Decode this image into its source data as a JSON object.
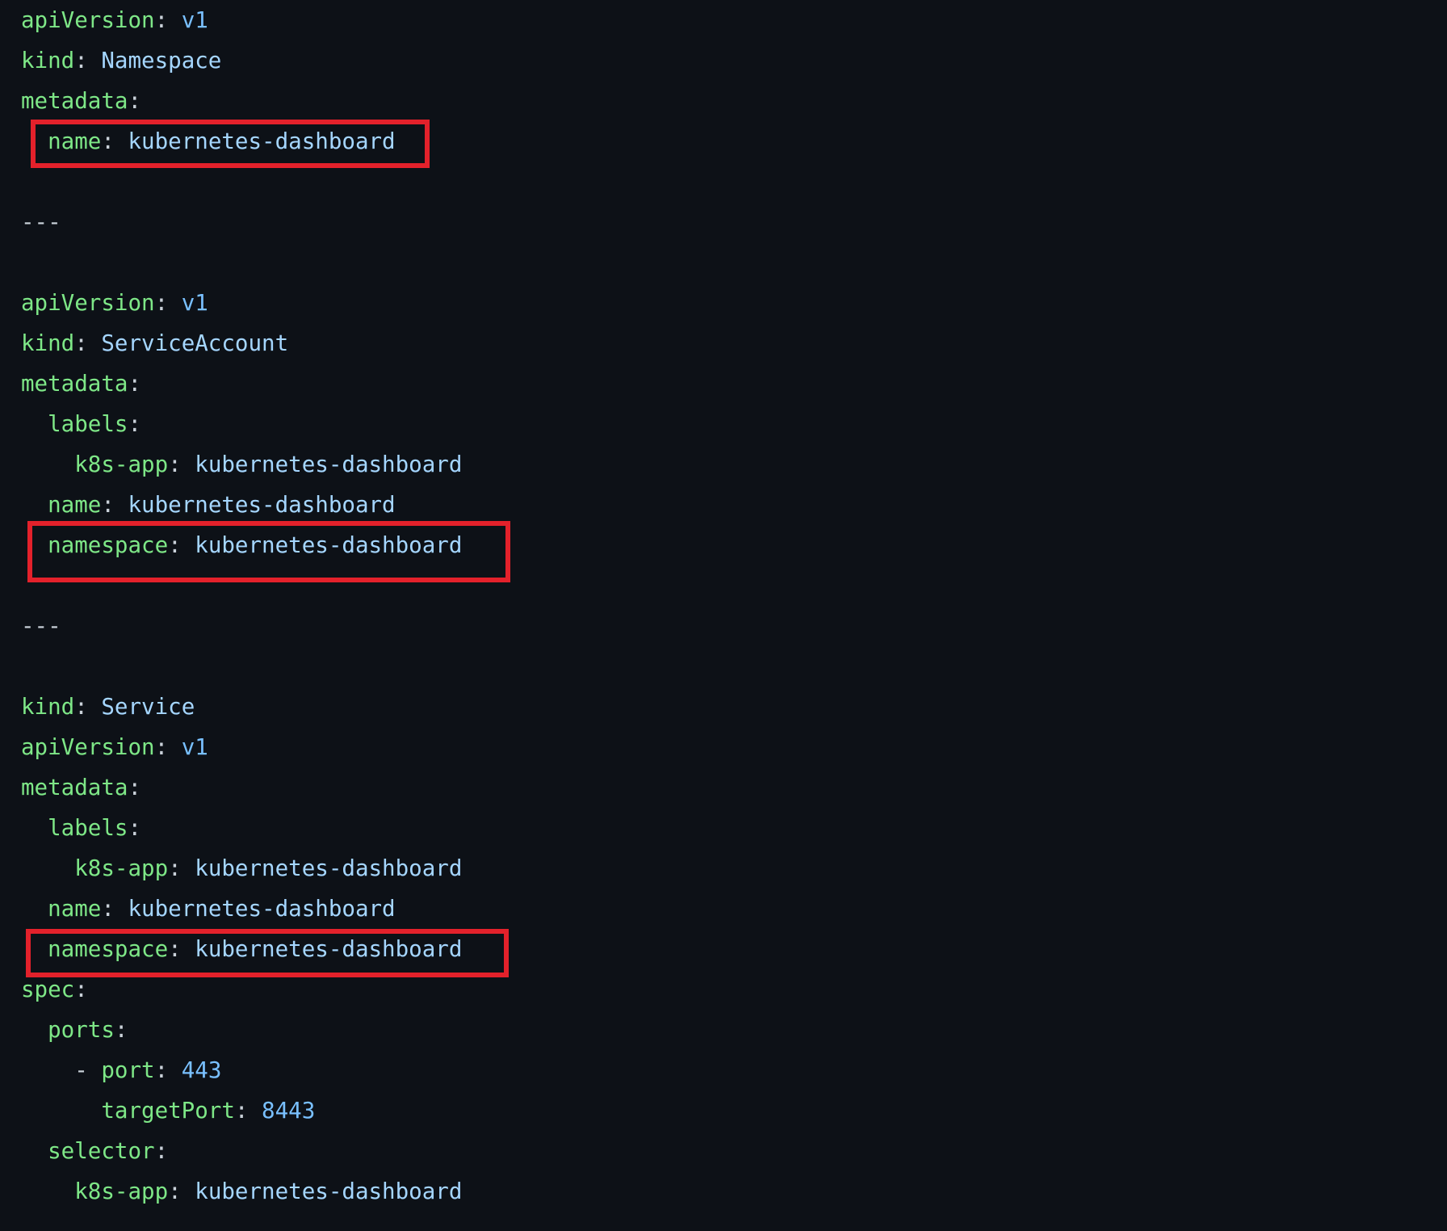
{
  "code_lines": [
    {
      "indent": "",
      "dash": "",
      "key": "apiVersion",
      "colon": ":",
      "value": "v1",
      "value_type": "number"
    },
    {
      "indent": "",
      "dash": "",
      "key": "kind",
      "colon": ":",
      "value": "Namespace",
      "value_type": "string"
    },
    {
      "indent": "",
      "dash": "",
      "key": "metadata",
      "colon": ":",
      "value": "",
      "value_type": "string"
    },
    {
      "indent": "  ",
      "dash": "",
      "key": "name",
      "colon": ":",
      "value": "kubernetes-dashboard",
      "value_type": "string"
    },
    {
      "indent": "",
      "dash": "",
      "key": "",
      "colon": "",
      "value": "",
      "value_type": "string"
    },
    {
      "indent": "",
      "dash": "",
      "key": "",
      "colon": "",
      "value": "---",
      "value_type": "separator"
    },
    {
      "indent": "",
      "dash": "",
      "key": "",
      "colon": "",
      "value": "",
      "value_type": "string"
    },
    {
      "indent": "",
      "dash": "",
      "key": "apiVersion",
      "colon": ":",
      "value": "v1",
      "value_type": "number"
    },
    {
      "indent": "",
      "dash": "",
      "key": "kind",
      "colon": ":",
      "value": "ServiceAccount",
      "value_type": "string"
    },
    {
      "indent": "",
      "dash": "",
      "key": "metadata",
      "colon": ":",
      "value": "",
      "value_type": "string"
    },
    {
      "indent": "  ",
      "dash": "",
      "key": "labels",
      "colon": ":",
      "value": "",
      "value_type": "string"
    },
    {
      "indent": "    ",
      "dash": "",
      "key": "k8s-app",
      "colon": ":",
      "value": "kubernetes-dashboard",
      "value_type": "string"
    },
    {
      "indent": "  ",
      "dash": "",
      "key": "name",
      "colon": ":",
      "value": "kubernetes-dashboard",
      "value_type": "string"
    },
    {
      "indent": "  ",
      "dash": "",
      "key": "namespace",
      "colon": ":",
      "value": "kubernetes-dashboard",
      "value_type": "string"
    },
    {
      "indent": "",
      "dash": "",
      "key": "",
      "colon": "",
      "value": "",
      "value_type": "string"
    },
    {
      "indent": "",
      "dash": "",
      "key": "",
      "colon": "",
      "value": "---",
      "value_type": "separator"
    },
    {
      "indent": "",
      "dash": "",
      "key": "",
      "colon": "",
      "value": "",
      "value_type": "string"
    },
    {
      "indent": "",
      "dash": "",
      "key": "kind",
      "colon": ":",
      "value": "Service",
      "value_type": "string"
    },
    {
      "indent": "",
      "dash": "",
      "key": "apiVersion",
      "colon": ":",
      "value": "v1",
      "value_type": "number"
    },
    {
      "indent": "",
      "dash": "",
      "key": "metadata",
      "colon": ":",
      "value": "",
      "value_type": "string"
    },
    {
      "indent": "  ",
      "dash": "",
      "key": "labels",
      "colon": ":",
      "value": "",
      "value_type": "string"
    },
    {
      "indent": "    ",
      "dash": "",
      "key": "k8s-app",
      "colon": ":",
      "value": "kubernetes-dashboard",
      "value_type": "string"
    },
    {
      "indent": "  ",
      "dash": "",
      "key": "name",
      "colon": ":",
      "value": "kubernetes-dashboard",
      "value_type": "string"
    },
    {
      "indent": "  ",
      "dash": "",
      "key": "namespace",
      "colon": ":",
      "value": "kubernetes-dashboard",
      "value_type": "string"
    },
    {
      "indent": "",
      "dash": "",
      "key": "spec",
      "colon": ":",
      "value": "",
      "value_type": "string"
    },
    {
      "indent": "  ",
      "dash": "",
      "key": "ports",
      "colon": ":",
      "value": "",
      "value_type": "string"
    },
    {
      "indent": "    ",
      "dash": "- ",
      "key": "port",
      "colon": ":",
      "value": "443",
      "value_type": "number"
    },
    {
      "indent": "      ",
      "dash": "",
      "key": "targetPort",
      "colon": ":",
      "value": "8443",
      "value_type": "number"
    },
    {
      "indent": "  ",
      "dash": "",
      "key": "selector",
      "colon": ":",
      "value": "",
      "value_type": "string"
    },
    {
      "indent": "    ",
      "dash": "",
      "key": "k8s-app",
      "colon": ":",
      "value": "kubernetes-dashboard",
      "value_type": "string"
    }
  ],
  "highlighted_lines": [
    3,
    13,
    23
  ],
  "colors": {
    "background": "#0d1117",
    "key": "#7ee787",
    "punctuation": "#c9d1d9",
    "string_value": "#a5d6ff",
    "number_value": "#79c0ff",
    "highlight_box": "#e3212b"
  }
}
